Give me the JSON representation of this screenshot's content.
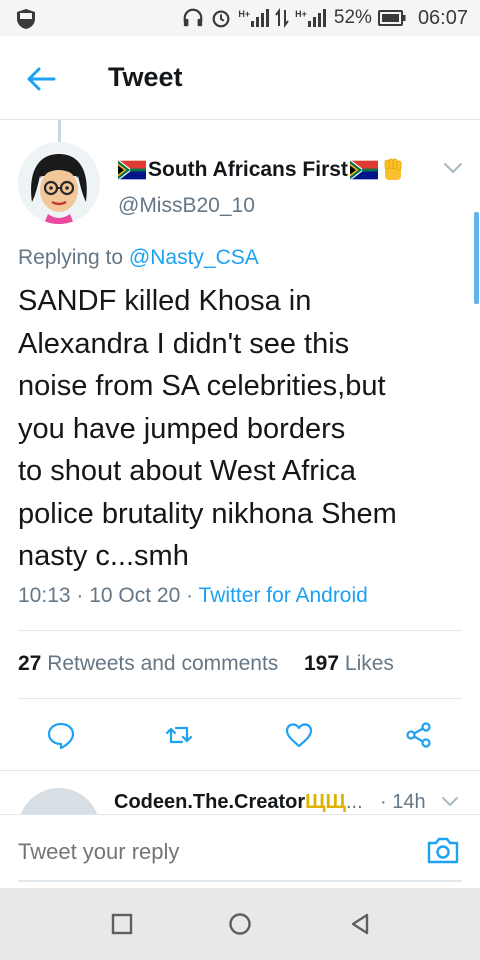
{
  "status_bar": {
    "battery_percent": "52%",
    "time": "06:07",
    "net_label_1": "H+",
    "net_label_2": "H+"
  },
  "header": {
    "title": "Tweet"
  },
  "tweet": {
    "display_name": "South Africans First",
    "handle": "@MissB20_10",
    "replying_prefix": "Replying to",
    "replying_to": "@Nasty_CSA",
    "text_lines": [
      "SANDF killed Khosa in",
      "Alexandra I didn't see this",
      "noise from SA celebrities,but",
      "you have jumped borders",
      "to shout about West Africa",
      "police brutality nikhona Shem",
      "nasty c...smh"
    ],
    "time": "10:13",
    "date": "10 Oct 20",
    "source": "Twitter for Android",
    "retweets_count": "27",
    "retweets_label": "Retweets and comments",
    "likes_count": "197",
    "likes_label": "Likes"
  },
  "reply_preview": {
    "name": "Codeen.The.Creator",
    "trident": "ЩЩ",
    "ellipsis": "...",
    "time": "· 14h"
  },
  "composer": {
    "placeholder": "Tweet your reply"
  },
  "icons": {
    "back": "arrow-left-icon",
    "caret": "chevron-down-icon",
    "reply": "comment-icon",
    "retweet": "retweet-icon",
    "like": "heart-icon",
    "share": "share-icon",
    "camera": "camera-icon"
  },
  "colors": {
    "accent": "#1da1f2",
    "muted": "#657786",
    "text": "#14171a"
  }
}
